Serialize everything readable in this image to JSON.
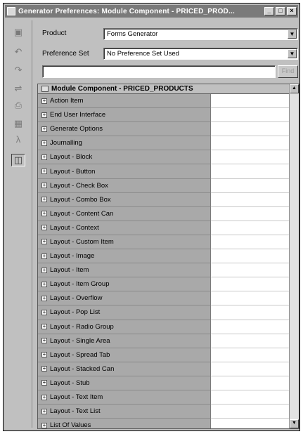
{
  "window": {
    "title": "Generator Preferences:  Module Component - PRICED_PROD...",
    "controls": {
      "minimize": "_",
      "maximize": "□",
      "close": "×"
    }
  },
  "toolbar": {
    "icons": [
      "save-icon",
      "undo-icon",
      "redo-icon",
      "filter-icon",
      "print-icon",
      "grid-icon",
      "font-icon",
      "properties-icon"
    ]
  },
  "form": {
    "product_label": "Product",
    "product_value": "Forms Generator",
    "preference_set_label": "Preference Set",
    "preference_set_value": "No Preference Set Used",
    "search_value": "",
    "find_button": "Find"
  },
  "grid": {
    "header": "Module Component - PRICED_PRODUCTS",
    "rows": [
      "Action Item",
      "End User Interface",
      "Generate Options",
      "Journalling",
      "Layout - Block",
      "Layout - Button",
      "Layout - Check Box",
      "Layout - Combo Box",
      "Layout - Content Can",
      "Layout - Context",
      "Layout - Custom Item",
      "Layout - Image",
      "Layout - Item",
      "Layout - Item Group",
      "Layout - Overflow",
      "Layout - Pop List",
      "Layout - Radio Group",
      "Layout - Single Area",
      "Layout - Spread Tab",
      "Layout - Stacked Can",
      "Layout - Stub",
      "Layout - Text Item",
      "Layout - Text List",
      "List Of Values"
    ]
  }
}
